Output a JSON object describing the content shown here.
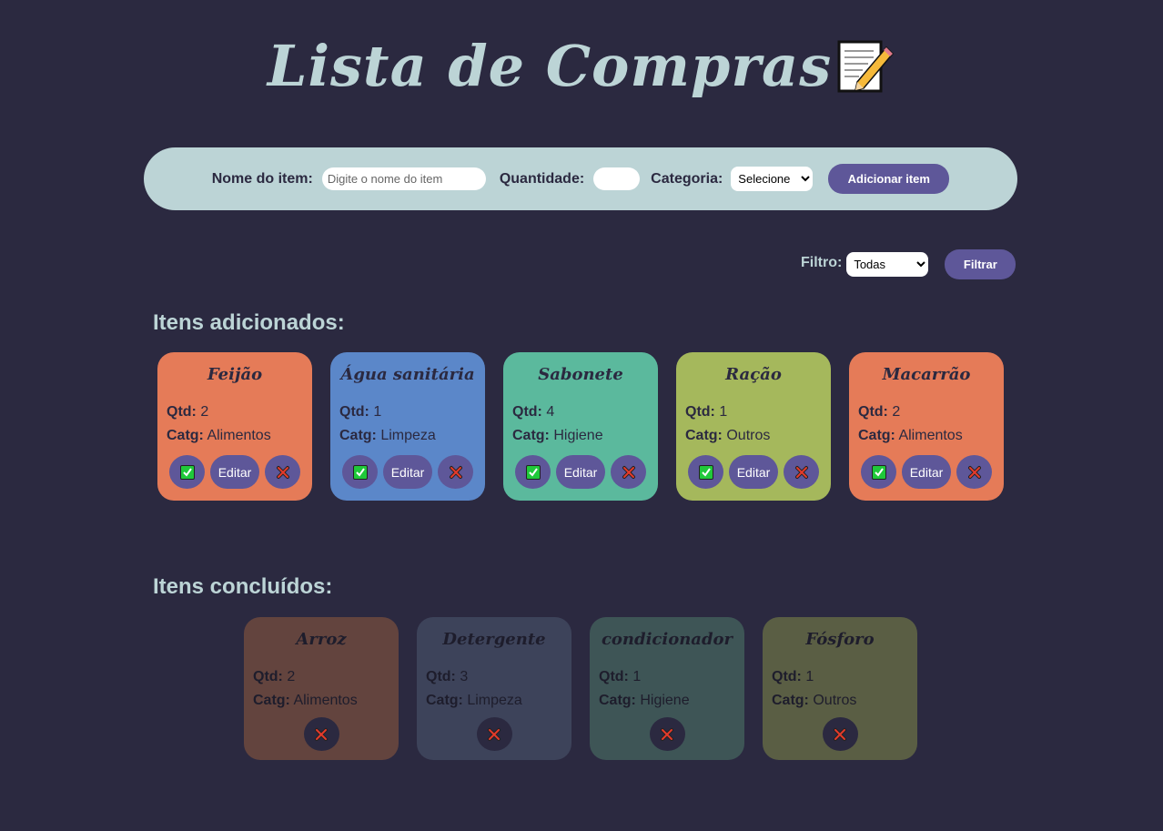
{
  "header": {
    "title": "Lista de Compras",
    "icon": "memo-pencil-icon"
  },
  "form": {
    "name_label": "Nome do item:",
    "name_placeholder": "Digite o nome do item",
    "qty_label": "Quantidade:",
    "category_label": "Categoria:",
    "category_selected": "Selecione",
    "add_button": "Adicionar item"
  },
  "filter": {
    "label": "Filtro:",
    "selected": "Todas",
    "button": "Filtrar"
  },
  "sections": {
    "added_title": "Itens adicionados:",
    "done_title": "Itens concluídos:"
  },
  "labels": {
    "qty": "Qtd:",
    "catg": "Catg:",
    "edit": "Editar"
  },
  "added_items": [
    {
      "name": "Feijão",
      "qty": "2",
      "category": "Alimentos",
      "color": "#e57b58"
    },
    {
      "name": "Água sanitária",
      "qty": "1",
      "category": "Limpeza",
      "color": "#5b87c9"
    },
    {
      "name": "Sabonete",
      "qty": "4",
      "category": "Higiene",
      "color": "#5bb99d"
    },
    {
      "name": "Ração",
      "qty": "1",
      "category": "Outros",
      "color": "#a5b85c"
    },
    {
      "name": "Macarrão",
      "qty": "2",
      "category": "Alimentos",
      "color": "#e57b58"
    }
  ],
  "done_items": [
    {
      "name": "Arroz",
      "qty": "2",
      "category": "Alimentos",
      "color": "#63443e"
    },
    {
      "name": "Detergente",
      "qty": "3",
      "category": "Limpeza",
      "color": "#3d435a"
    },
    {
      "name": "condicionador",
      "qty": "1",
      "category": "Higiene",
      "color": "#3e5556"
    },
    {
      "name": "Fósforo",
      "qty": "1",
      "category": "Outros",
      "color": "#5a5e44"
    }
  ],
  "colors": {
    "background": "#2b2940",
    "accent": "#5e5799",
    "light": "#bcd4d6"
  }
}
